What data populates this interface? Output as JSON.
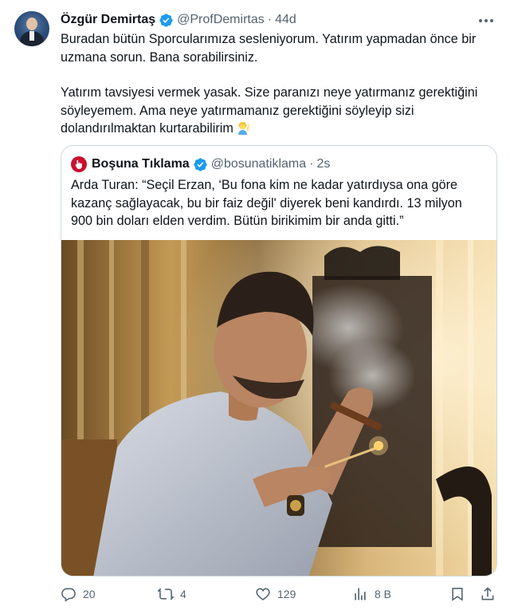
{
  "author": {
    "name": "Özgür Demirtaş",
    "handle": "@ProfDemirtas",
    "separator": "·",
    "time": "44d"
  },
  "tweet": {
    "paragraph1_line1": "Buradan bütün Sporcularımıza sesleniyorum. Yatırım yapmadan önce bir",
    "paragraph1_line2": "uzmana sorun. Bana sorabilirsiniz.",
    "paragraph2_line1": "Yatırım tavsiyesi vermek yasak. Size paranızı neye yatırmanız gerektiğini",
    "paragraph2_line2": "söyleyemem. Ama neye yatırmamanız gerektiğini söyleyip sizi",
    "paragraph2_line3": "dolandırılmaktan kurtarabilirim",
    "emoji": "person-raising-hand-emoji"
  },
  "quoted": {
    "name": "Boşuna Tıklama",
    "handle": "@bosunatiklama",
    "separator": "·",
    "time": "2s",
    "line1": "Arda Turan: “Seçil Erzan, ‘Bu fona kim ne kadar yatırdıysa ona göre",
    "line2": "kazanç sağlayacak, bu bir faiz değil' diyerek beni kandırdı. 13 milyon",
    "line3": "900 bin doları elden verdim. Bütün birikimim bir anda gitti.”",
    "photo": "man-lighting-cigar-photo"
  },
  "actions": {
    "replies": "20",
    "reposts": "4",
    "likes": "129",
    "views": "8 B"
  },
  "colors": {
    "verified": "#1d9bf0",
    "secondary_text": "#536471",
    "border": "#cfd9de",
    "quoted_avatar": "#c8102e"
  }
}
